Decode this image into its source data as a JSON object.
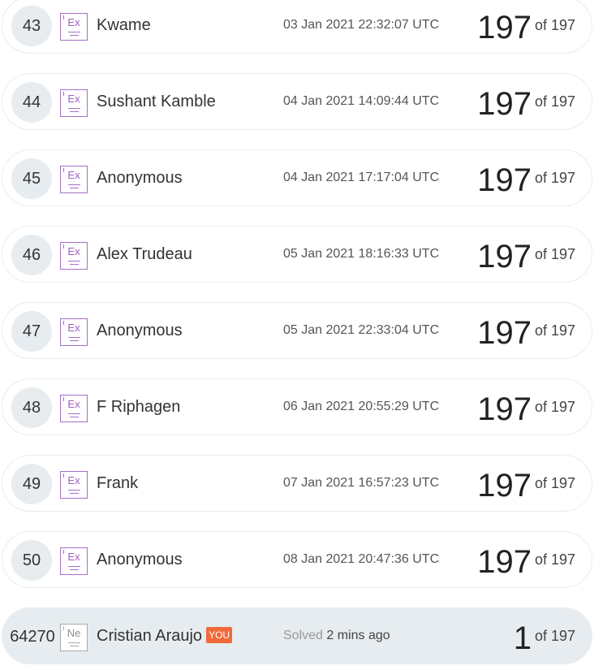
{
  "leaderboard": {
    "rows": [
      {
        "rank": "43",
        "badge": "Ex",
        "name": "Kwame",
        "date": "03 Jan 2021 22:32:07 UTC",
        "score": "197",
        "of_label": "of 197"
      },
      {
        "rank": "44",
        "badge": "Ex",
        "name": "Sushant Kamble",
        "date": "04 Jan 2021 14:09:44 UTC",
        "score": "197",
        "of_label": "of 197"
      },
      {
        "rank": "45",
        "badge": "Ex",
        "name": "Anonymous",
        "date": "04 Jan 2021 17:17:04 UTC",
        "score": "197",
        "of_label": "of 197"
      },
      {
        "rank": "46",
        "badge": "Ex",
        "name": "Alex Trudeau",
        "date": "05 Jan 2021 18:16:33 UTC",
        "score": "197",
        "of_label": "of 197"
      },
      {
        "rank": "47",
        "badge": "Ex",
        "name": "Anonymous",
        "date": "05 Jan 2021 22:33:04 UTC",
        "score": "197",
        "of_label": "of 197"
      },
      {
        "rank": "48",
        "badge": "Ex",
        "name": "F Riphagen",
        "date": "06 Jan 2021 20:55:29 UTC",
        "score": "197",
        "of_label": "of 197"
      },
      {
        "rank": "49",
        "badge": "Ex",
        "name": "Frank",
        "date": "07 Jan 2021 16:57:23 UTC",
        "score": "197",
        "of_label": "of 197"
      },
      {
        "rank": "50",
        "badge": "Ex",
        "name": "Anonymous",
        "date": "08 Jan 2021 20:47:36 UTC",
        "score": "197",
        "of_label": "of 197"
      }
    ],
    "current_user": {
      "rank": "64270",
      "badge": "Ne",
      "name": "Cristian Araujo",
      "you_tag": "YOU",
      "solved_label": "Solved",
      "solved_ago": "2 mins ago",
      "score": "1",
      "of_label": "of 197"
    }
  },
  "colors": {
    "expert_badge": "#a56fc6",
    "novice_badge": "#a9a9a9",
    "you_tag": "#f26a3a",
    "current_row_bg": "#e6ecef",
    "rank_circle_bg": "#e6ecef"
  },
  "icons": {
    "expert_badge_icon": "expert-level-badge",
    "novice_badge_icon": "novice-level-badge"
  }
}
